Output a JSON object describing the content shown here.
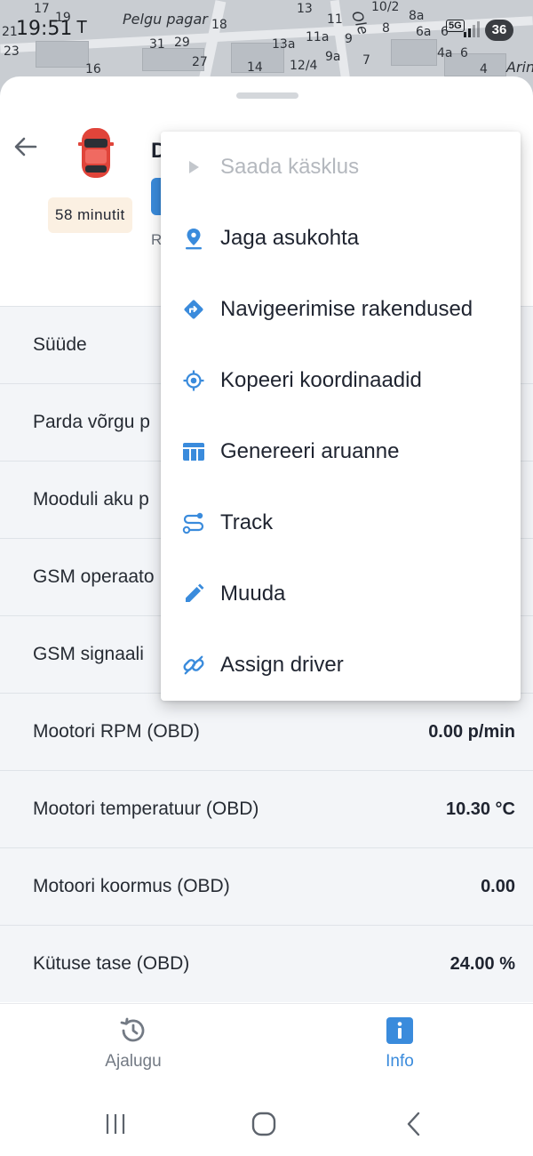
{
  "status_bar": {
    "time": "19:51",
    "network": "5G",
    "battery": "36"
  },
  "map": {
    "street_top": "Pelgu pagar",
    "street_right": "Ole",
    "street_corner": "Arin",
    "house_numbers": [
      "17",
      "19",
      "31",
      "29",
      "18",
      "13",
      "11",
      "10/2",
      "8a",
      "6a",
      "21",
      "23",
      "16",
      "27",
      "14",
      "13a",
      "11a",
      "9",
      "8",
      "6",
      "12/4",
      "9a",
      "7",
      "6",
      "4a",
      "4"
    ]
  },
  "vehicle": {
    "title_initial": "D",
    "subtitle_initial": "R",
    "time_chip": "58 minutit"
  },
  "info_rows": [
    {
      "label": "Süüde",
      "value": ""
    },
    {
      "label": "Parda võrgu p",
      "value": ""
    },
    {
      "label": "Mooduli aku p",
      "value": ""
    },
    {
      "label": "GSM operaato",
      "value": ""
    },
    {
      "label": "GSM signaali",
      "value": ""
    },
    {
      "label": "Mootori RPM (OBD)",
      "value": "0.00 p/min"
    },
    {
      "label": "Mootori temperatuur (OBD)",
      "value": "10.30 °C"
    },
    {
      "label": "Motoori koormus (OBD)",
      "value": "0.00"
    },
    {
      "label": "Kütuse tase (OBD)",
      "value": "24.00 %"
    }
  ],
  "menu": {
    "items": [
      {
        "label": "Saada käsklus",
        "icon": "play-icon",
        "disabled": true
      },
      {
        "label": "Jaga asukohta",
        "icon": "location-pin-icon"
      },
      {
        "label": "Navigeerimise rakendused",
        "icon": "directions-icon"
      },
      {
        "label": "Kopeeri koordinaadid",
        "icon": "gps-crosshair-icon"
      },
      {
        "label": "Genereeri aruanne",
        "icon": "table-icon"
      },
      {
        "label": "Track",
        "icon": "route-icon"
      },
      {
        "label": "Muuda",
        "icon": "pencil-icon"
      },
      {
        "label": "Assign driver",
        "icon": "link-icon"
      }
    ]
  },
  "bottom_nav": {
    "history_label": "Ajalugu",
    "info_label": "Info"
  },
  "colors": {
    "accent": "#3a8bdc",
    "row_bg": "#f3f5f8",
    "chip_bg": "#fbf0e2",
    "car_red": "#e0443a"
  }
}
